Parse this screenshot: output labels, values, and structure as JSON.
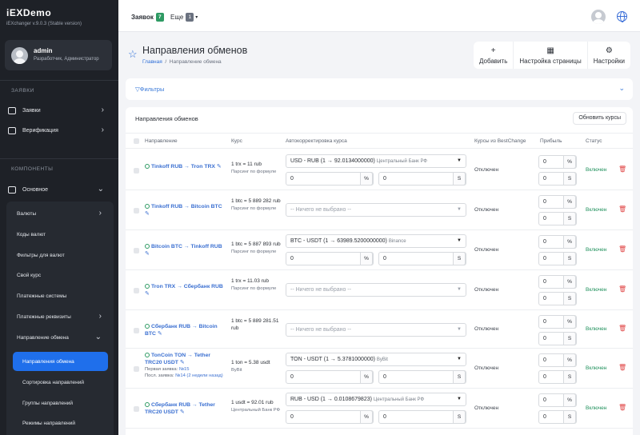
{
  "sidebar": {
    "brand": "iEXDemo",
    "version": "iEXchanger v.9.0.3 (Stable version)",
    "user": {
      "name": "admin",
      "role": "Разработчик, Администратор"
    },
    "section_orders": "ЗАЯВКИ",
    "orders": "Заявки",
    "verification": "Верификация",
    "section_components": "КОМПОНЕНТЫ",
    "main": "Основное",
    "sub_items": [
      "Валюты",
      "Коды валют",
      "Фильтры для валют",
      "Свой курс",
      "Платежные системы",
      "Платежные реквизиты",
      "Направление обмена"
    ],
    "sub2_items": [
      "Направления обмена",
      "Сортировка направлений",
      "Группы направлений",
      "Режимы направлений"
    ]
  },
  "topbar": {
    "orders_label": "Заявок",
    "orders_count": "7",
    "more_label": "Еще",
    "more_count": "1"
  },
  "page": {
    "title": "Направления обменов",
    "breadcrumb_home": "Главная",
    "breadcrumb_current": "Направление обмена",
    "actions": [
      {
        "icon": "+",
        "label": "Добавить"
      },
      {
        "icon": "▦",
        "label": "Настройка страницы"
      },
      {
        "icon": "⚙",
        "label": "Настройки"
      }
    ],
    "filters_label": "Фильтры"
  },
  "table": {
    "title": "Направления обменов",
    "refresh_label": "Обновить курсы",
    "headers": {
      "direction": "Направление",
      "rate": "Курс",
      "auto": "Автокорректировка курса",
      "bestchange": "Курсы из BestChange",
      "profit": "Прибыль",
      "status": "Статус"
    },
    "rows": [
      {
        "dir": "Tinkoff RUB → Tron TRX",
        "rate": "1 trx = 11 rub",
        "rate_sub": "Парсинг по формуле",
        "select": "USD - RUB (1 → 92.0134000000)",
        "source": "Центральный Банк РФ",
        "has_inputs": true,
        "pct": "0",
        "abs": "0",
        "bc": "Отключен",
        "profit_pct": "0",
        "profit_abs": "0",
        "status": "Включен"
      },
      {
        "dir": "Tinkoff RUB → Bitcoin BTC",
        "rate": "1 btc = 5 889 282 rub",
        "rate_sub": "Парсинг по формуле",
        "select": "-- Ничего не выбрано --",
        "source": "",
        "has_inputs": false,
        "bc": "Отключен",
        "profit_pct": "0",
        "profit_abs": "0",
        "status": "Включен"
      },
      {
        "dir": "Bitcoin BTC → Tinkoff RUB",
        "rate": "1 btc = 5 887 893 rub",
        "rate_sub": "Парсинг по формуле",
        "select": "BTC - USDT (1 → 63989.5200000000)",
        "source": "Binance",
        "has_inputs": true,
        "pct": "0",
        "abs": "0",
        "bc": "Отключен",
        "profit_pct": "0",
        "profit_abs": "0",
        "status": "Включен"
      },
      {
        "dir": "Tron TRX → Сбербанк RUB",
        "rate": "1 trx = 11.03 rub",
        "rate_sub": "Парсинг по формуле",
        "select": "-- Ничего не выбрано --",
        "source": "",
        "has_inputs": false,
        "bc": "Отключен",
        "profit_pct": "0",
        "profit_abs": "0",
        "status": "Включен"
      },
      {
        "dir": "Сбербанк RUB → Bitcoin BTC",
        "rate": "1 btc = 5 889 281.51 rub",
        "rate_sub": "",
        "select": "-- Ничего не выбрано --",
        "source": "",
        "has_inputs": false,
        "bc": "Отключен",
        "profit_pct": "0",
        "profit_abs": "0",
        "status": "Включен"
      },
      {
        "dir": "TonCoin TON → Tether TRC20 USDT",
        "first_label": "Первая заявка:",
        "first_val": "№15",
        "last_label": "Посл. заявка:",
        "last_val": "№14 (2 недели назад)",
        "rate": "1 ton = 5.38 usdt",
        "rate_sub": "ByBit",
        "select": "TON - USDT (1 → 5.3781000000)",
        "source": "ByBit",
        "has_inputs": true,
        "pct": "0",
        "abs": "0",
        "bc": "Отключен",
        "profit_pct": "0",
        "profit_abs": "0",
        "status": "Включен"
      },
      {
        "dir": "Сбербанк RUB → Tether TRC20 USDT",
        "rate": "1 usdt = 92.01 rub",
        "rate_sub": "Центральный Банк РФ",
        "select": "RUB - USD (1 → 0.0108679823)",
        "source": "Центральный Банк РФ",
        "has_inputs": true,
        "pct": "0",
        "abs": "0",
        "bc": "Отключен",
        "profit_pct": "0",
        "profit_abs": "0",
        "status": "Включен"
      }
    ]
  },
  "colors": {
    "accent": "#1f6feb",
    "status_on": "#1d8f5a",
    "delete": "#e04545",
    "badge_green": "#2e9a63",
    "badge_gray": "#6b7280"
  }
}
